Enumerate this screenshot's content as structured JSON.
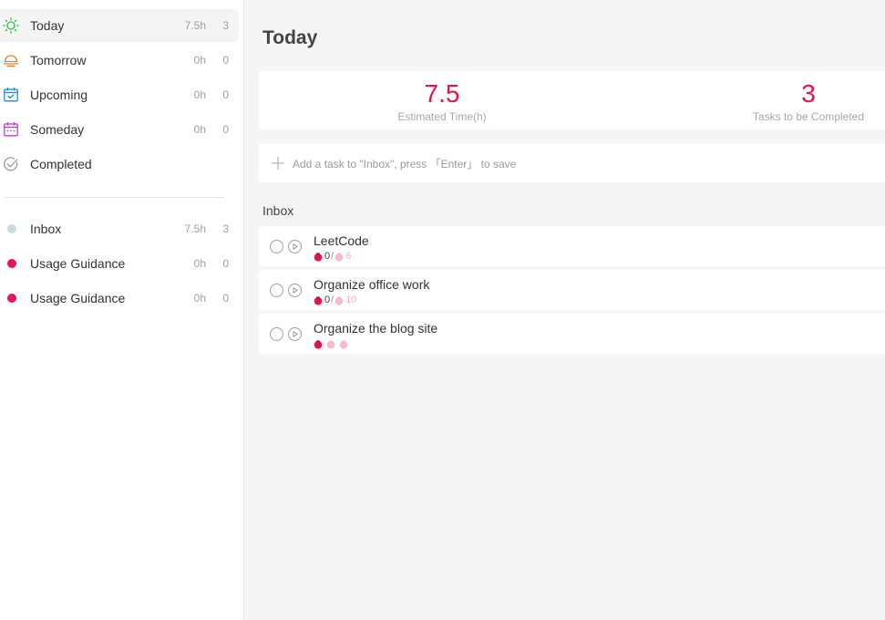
{
  "sidebar": {
    "views": [
      {
        "label": "Today",
        "hours": "7.5h",
        "count": "3",
        "active": true
      },
      {
        "label": "Tomorrow",
        "hours": "0h",
        "count": "0"
      },
      {
        "label": "Upcoming",
        "hours": "0h",
        "count": "0"
      },
      {
        "label": "Someday",
        "hours": "0h",
        "count": "0"
      },
      {
        "label": "Completed"
      }
    ],
    "projects": [
      {
        "label": "Inbox",
        "hours": "7.5h",
        "count": "3",
        "color": "#c9dde0"
      },
      {
        "label": "Usage Guidance",
        "hours": "0h",
        "count": "0",
        "color": "#e8135a"
      },
      {
        "label": "Usage Guidance",
        "hours": "0h",
        "count": "0",
        "color": "#e8135a"
      }
    ],
    "icon_colors": {
      "today": "#2bc24a",
      "tomorrow": "#f07a1c",
      "upcoming": "#1d8ed9",
      "someday": "#b53fd1",
      "completed": "#9b9b9b"
    }
  },
  "main": {
    "title": "Today",
    "stats": {
      "estimated_value": "7.5",
      "estimated_label": "Estimated Time(h)",
      "tasks_value": "3",
      "tasks_label": "Tasks to be Completed"
    },
    "add_task_placeholder": "Add a task to \"Inbox\", press 「Enter」 to save",
    "section": "Inbox",
    "tasks": [
      {
        "title": "LeetCode",
        "done": "0",
        "sep": "/",
        "estimate": "6"
      },
      {
        "title": "Organize office work",
        "done": "0",
        "sep": "/",
        "estimate": "10"
      },
      {
        "title": "Organize the blog site",
        "pomodoros_done": 1,
        "pomodoros_total": 3
      }
    ]
  },
  "colors": {
    "accent": "#e8134a",
    "pomodoro_done": "#e8134a",
    "pomodoro_todo": "#f7bccb"
  }
}
